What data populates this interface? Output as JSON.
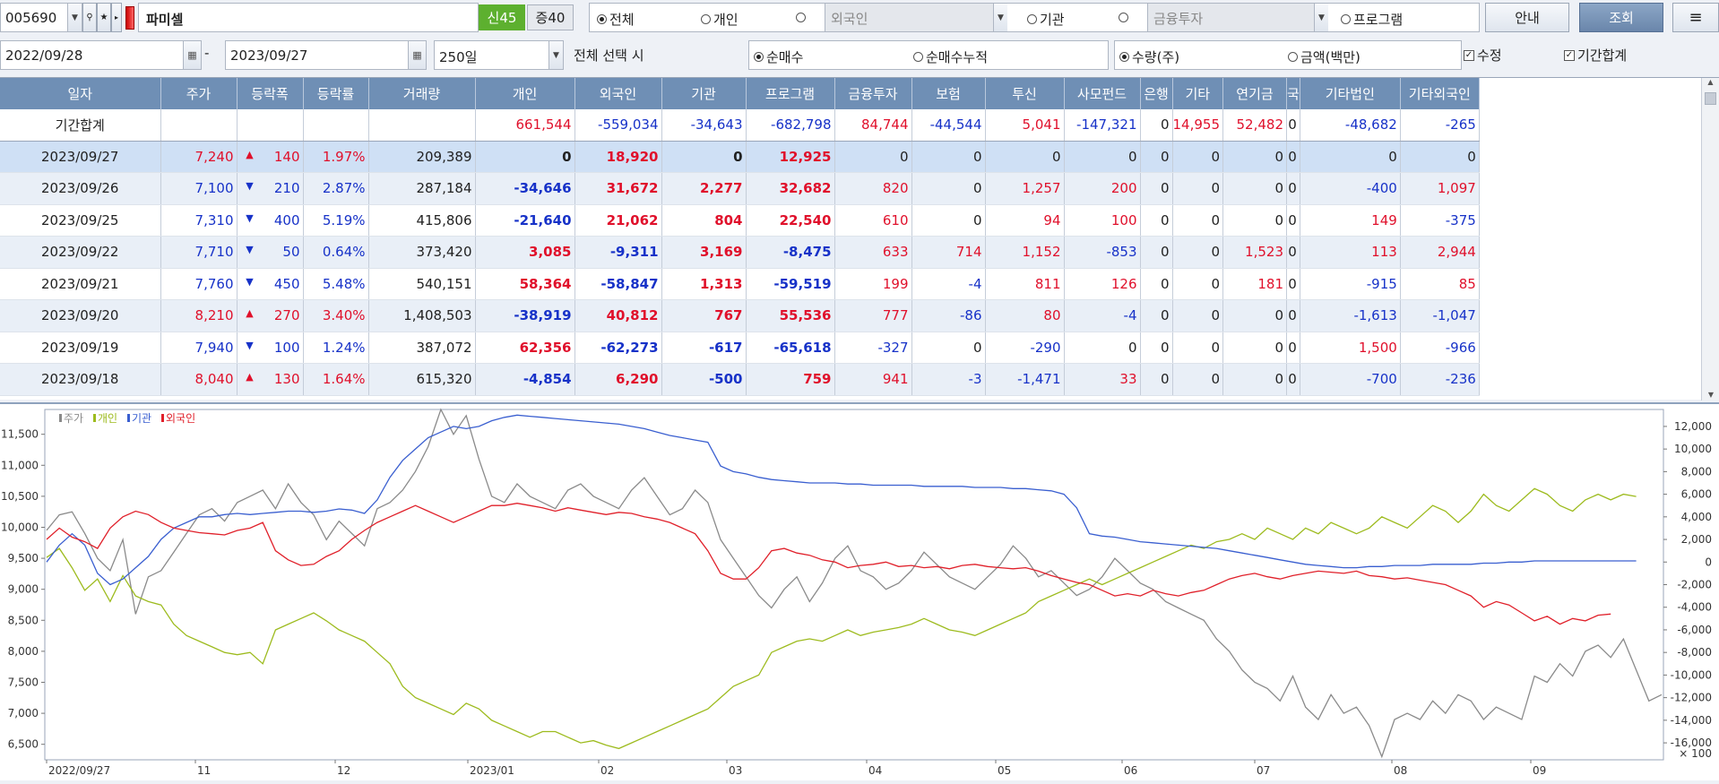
{
  "toolbar": {
    "code": "005690",
    "name": "파미셀",
    "badge_new": "신45",
    "badge_margin": "증40",
    "radios": [
      "전체",
      "개인",
      "외국인",
      "기관",
      "금융투자",
      "프로그램"
    ],
    "foreign_placeholder": "외국인",
    "fin_placeholder": "금융투자",
    "guide_label": "안내",
    "search_label": "조회",
    "menu_icon": "≡"
  },
  "filters": {
    "date_from": "2022/09/28",
    "date_sep": "-",
    "date_to": "2023/09/27",
    "period": "250일",
    "hint": "전체 선택 시",
    "mode_net": "순매수",
    "mode_cum": "순매수누적",
    "unit_qty": "수량(주)",
    "unit_amt": "금액(백만)",
    "chk_adjust": "수정",
    "chk_total": "기간합계"
  },
  "table": {
    "headers": [
      "일자",
      "주가",
      "등락폭",
      "등락률",
      "거래량",
      "개인",
      "외국인",
      "기관",
      "프로그램",
      "금융투자",
      "보험",
      "투신",
      "사모펀드",
      "은행",
      "기타",
      "연기금",
      "국",
      "기타법인",
      "기타외국인"
    ],
    "summary": [
      "기간합계",
      "",
      "",
      "",
      "",
      "661,544",
      "-559,034",
      "-34,643",
      "-682,798",
      "84,744",
      "-44,544",
      "5,041",
      "-147,321",
      "0",
      "14,955",
      "52,482",
      "0",
      "-48,682",
      "-265"
    ],
    "rows": [
      [
        "2023/09/27",
        "7,240",
        "up",
        "140",
        "1.97%",
        "209,389",
        "0",
        "18,920",
        "0",
        "12,925",
        "0",
        "0",
        "0",
        "0",
        "0",
        "0",
        "0",
        "0",
        "0",
        "0"
      ],
      [
        "2023/09/26",
        "7,100",
        "down",
        "210",
        "2.87%",
        "287,184",
        "-34,646",
        "31,672",
        "2,277",
        "32,682",
        "820",
        "0",
        "1,257",
        "200",
        "0",
        "0",
        "0",
        "0",
        "-400",
        "1,097"
      ],
      [
        "2023/09/25",
        "7,310",
        "down",
        "400",
        "5.19%",
        "415,806",
        "-21,640",
        "21,062",
        "804",
        "22,540",
        "610",
        "0",
        "94",
        "100",
        "0",
        "0",
        "0",
        "0",
        "149",
        "-375"
      ],
      [
        "2023/09/22",
        "7,710",
        "down",
        "50",
        "0.64%",
        "373,420",
        "3,085",
        "-9,311",
        "3,169",
        "-8,475",
        "633",
        "714",
        "1,152",
        "-853",
        "0",
        "0",
        "1,523",
        "0",
        "113",
        "2,944"
      ],
      [
        "2023/09/21",
        "7,760",
        "down",
        "450",
        "5.48%",
        "540,151",
        "58,364",
        "-58,847",
        "1,313",
        "-59,519",
        "199",
        "-4",
        "811",
        "126",
        "0",
        "0",
        "181",
        "0",
        "-915",
        "85"
      ],
      [
        "2023/09/20",
        "8,210",
        "up",
        "270",
        "3.40%",
        "1,408,503",
        "-38,919",
        "40,812",
        "767",
        "55,536",
        "777",
        "-86",
        "80",
        "-4",
        "0",
        "0",
        "0",
        "0",
        "-1,613",
        "-1,047"
      ],
      [
        "2023/09/19",
        "7,940",
        "down",
        "100",
        "1.24%",
        "387,072",
        "62,356",
        "-62,273",
        "-617",
        "-65,618",
        "-327",
        "0",
        "-290",
        "0",
        "0",
        "0",
        "0",
        "0",
        "1,500",
        "-966"
      ],
      [
        "2023/09/18",
        "8,040",
        "up",
        "130",
        "1.64%",
        "615,320",
        "-4,854",
        "6,290",
        "-500",
        "759",
        "941",
        "-3",
        "-1,471",
        "33",
        "0",
        "0",
        "0",
        "0",
        "-700",
        "-236"
      ]
    ]
  },
  "chart_data": {
    "type": "line",
    "legend": [
      "주가",
      "개인",
      "기관",
      "외국인"
    ],
    "colors": {
      "price": "#8a8a8a",
      "individual": "#9dbb1e",
      "institution": "#3a5fd0",
      "foreign": "#e0202a"
    },
    "x_ticks": [
      "2022/09/27",
      "11",
      "12",
      "2023/01",
      "02",
      "03",
      "04",
      "05",
      "06",
      "07",
      "08",
      "09"
    ],
    "y_left_ticks": [
      "11,500",
      "11,000",
      "10,500",
      "10,000",
      "9,500",
      "9,000",
      "8,500",
      "8,000",
      "7,500",
      "7,000",
      "6,500"
    ],
    "y_left_range": [
      6250,
      11900
    ],
    "y_right_ticks": [
      "12,000",
      "10,000",
      "8,000",
      "6,000",
      "4,000",
      "2,000",
      "0",
      "-2,000",
      "-4,000",
      "-6,000",
      "-8,000",
      "-10,000",
      "-12,000",
      "-14,000",
      "-16,000"
    ],
    "y_right_range": [
      -17500,
      13500
    ],
    "y_right_unit": "× 100",
    "price": [
      9950,
      10200,
      10250,
      9900,
      9500,
      9300,
      9800,
      8600,
      9200,
      9300,
      9600,
      9900,
      10200,
      10300,
      10100,
      10400,
      10500,
      10600,
      10300,
      10700,
      10400,
      10200,
      9800,
      10100,
      9900,
      9700,
      10300,
      10400,
      10600,
      10900,
      11300,
      11900,
      11500,
      11800,
      11100,
      10500,
      10400,
      10700,
      10500,
      10400,
      10300,
      10600,
      10700,
      10500,
      10400,
      10300,
      10600,
      10800,
      10500,
      10200,
      10300,
      10600,
      10400,
      9800,
      9500,
      9200,
      8900,
      8700,
      9000,
      9200,
      8800,
      9100,
      9500,
      9700,
      9300,
      9200,
      9000,
      9100,
      9300,
      9600,
      9400,
      9200,
      9100,
      9000,
      9200,
      9400,
      9700,
      9500,
      9200,
      9300,
      9100,
      8900,
      9000,
      9200,
      9500,
      9300,
      9100,
      9000,
      8800,
      8700,
      8600,
      8500,
      8200,
      8000,
      7700,
      7500,
      7400,
      7200,
      7600,
      7100,
      6900,
      7300,
      7000,
      7100,
      6800,
      6300,
      6900,
      7000,
      6900,
      7200,
      7000,
      7300,
      7200,
      6900,
      7100,
      7000,
      6900,
      7600,
      7500,
      7800,
      7600,
      8000,
      8100,
      7900,
      8200,
      7700,
      7200,
      7300
    ],
    "individual": [
      400,
      1200,
      -500,
      -2500,
      -1500,
      -3500,
      -1200,
      -3000,
      -3500,
      -3800,
      -5500,
      -6500,
      -7000,
      -7500,
      -8000,
      -8200,
      -8000,
      -9000,
      -6000,
      -5500,
      -5000,
      -4500,
      -5200,
      -6000,
      -6500,
      -7000,
      -8000,
      -9000,
      -11000,
      -12000,
      -12500,
      -13000,
      -13500,
      -12500,
      -13000,
      -14000,
      -14500,
      -15000,
      -15500,
      -15000,
      -15000,
      -15500,
      -16000,
      -15800,
      -16200,
      -16500,
      -16000,
      -15500,
      -15000,
      -14500,
      -14000,
      -13500,
      -13000,
      -12000,
      -11000,
      -10500,
      -10000,
      -8000,
      -7500,
      -7000,
      -6800,
      -7000,
      -6500,
      -6000,
      -6500,
      -6200,
      -6000,
      -5800,
      -5500,
      -5000,
      -5500,
      -6000,
      -6200,
      -6500,
      -6000,
      -5500,
      -5000,
      -4500,
      -3500,
      -3000,
      -2500,
      -2000,
      -1500,
      -2000,
      -1500,
      -1000,
      -500,
      0,
      500,
      1000,
      1500,
      1200,
      1800,
      2000,
      2500,
      2000,
      3000,
      2500,
      2000,
      3000,
      2500,
      3500,
      3000,
      2500,
      3000,
      4000,
      3500,
      3000,
      4000,
      5000,
      4500,
      3500,
      4500,
      6000,
      5000,
      4500,
      5500,
      6500,
      6000,
      5000,
      4500,
      5500,
      6000,
      5500,
      6000,
      5800
    ],
    "institution": [
      0,
      1500,
      2500,
      1500,
      -1000,
      -2000,
      -1500,
      -500,
      500,
      2000,
      3000,
      3500,
      4000,
      4000,
      4200,
      4300,
      4200,
      4300,
      4400,
      4500,
      4500,
      4400,
      4500,
      4700,
      4600,
      4300,
      5500,
      7500,
      9000,
      10000,
      11000,
      11500,
      12000,
      11800,
      12000,
      12500,
      12800,
      13000,
      12900,
      12800,
      12700,
      12600,
      12500,
      12400,
      12300,
      12200,
      12000,
      11800,
      11500,
      11200,
      11000,
      10800,
      10600,
      8500,
      8000,
      7800,
      7500,
      7300,
      7200,
      7100,
      7000,
      7000,
      7000,
      6900,
      6900,
      6800,
      6800,
      6800,
      6800,
      6700,
      6700,
      6700,
      6700,
      6600,
      6600,
      6600,
      6500,
      6500,
      6400,
      6300,
      6000,
      4800,
      2500,
      2300,
      2200,
      2000,
      1800,
      1700,
      1600,
      1500,
      1400,
      1300,
      1200,
      1000,
      800,
      600,
      400,
      200,
      0,
      -200,
      -300,
      -400,
      -500,
      -500,
      -400,
      -400,
      -300,
      -300,
      -300,
      -200,
      -200,
      -200,
      -200,
      -100,
      -100,
      0,
      0,
      100,
      100,
      100,
      100,
      100,
      100,
      100,
      100,
      100
    ],
    "foreign": [
      2000,
      3000,
      2200,
      1800,
      1200,
      3000,
      4000,
      4500,
      4200,
      3500,
      3000,
      2800,
      2600,
      2500,
      2400,
      2800,
      3000,
      3500,
      1000,
      200,
      -300,
      -200,
      500,
      1000,
      2000,
      2800,
      3500,
      4000,
      4500,
      5000,
      4500,
      4000,
      3500,
      4000,
      4500,
      5000,
      5000,
      5200,
      5000,
      4800,
      4500,
      4800,
      4600,
      4400,
      4200,
      4400,
      4300,
      4000,
      3800,
      3500,
      3000,
      2500,
      1000,
      -1000,
      -1500,
      -1500,
      -500,
      1000,
      1200,
      800,
      600,
      200,
      0,
      -500,
      -300,
      -200,
      0,
      -400,
      -300,
      -500,
      -400,
      -600,
      -300,
      -200,
      -400,
      -500,
      -600,
      -500,
      -800,
      -1200,
      -1500,
      -1800,
      -2000,
      -2500,
      -3000,
      -2800,
      -3000,
      -2500,
      -2800,
      -3000,
      -2700,
      -2500,
      -2000,
      -1500,
      -1200,
      -1000,
      -1300,
      -1500,
      -1200,
      -1000,
      -800,
      -900,
      -1000,
      -800,
      -1200,
      -1300,
      -1500,
      -1400,
      -1600,
      -1800,
      -2000,
      -2500,
      -3000,
      -4000,
      -3500,
      -3800,
      -4500,
      -5200,
      -4800,
      -5500,
      -5000,
      -5200,
      -4700,
      -4600
    ]
  }
}
